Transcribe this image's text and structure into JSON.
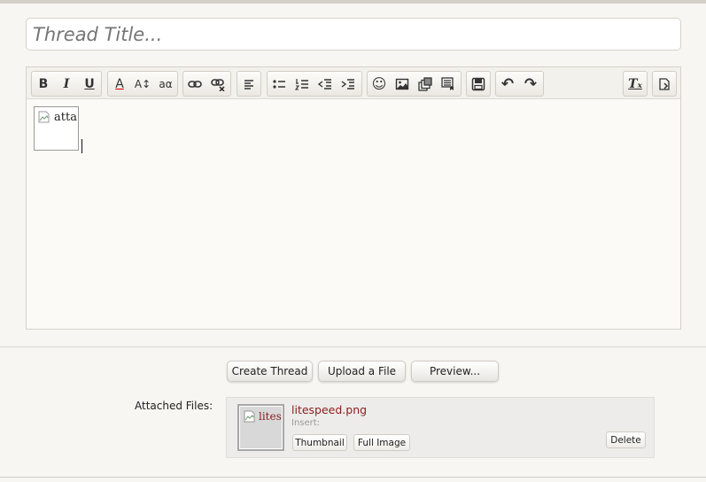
{
  "title_input": {
    "placeholder": "Thread Title..."
  },
  "toolbar": {
    "bold": "B",
    "italic": "I",
    "underline": "U",
    "text_color": "A",
    "font_size": "A↕",
    "font_family": "aα",
    "link": "link-icon",
    "unlink": "unlink-icon",
    "align": "align-left-icon",
    "bulleted_list": "bulleted-list-icon",
    "numbered_list": "numbered-list-icon",
    "outdent": "outdent-icon",
    "indent": "indent-icon",
    "smilies": "☺",
    "image": "image-icon",
    "media": "media-icon",
    "insert": "insert-icon",
    "save_draft": "save-icon",
    "undo": "↶",
    "redo": "↷",
    "remove_format": "Tₓ",
    "switch_mode": "toggle-bbcode-icon"
  },
  "editor": {
    "broken_image_alt": "atta"
  },
  "actions": {
    "create_thread": "Create Thread",
    "upload_file": "Upload a File",
    "preview": "Preview..."
  },
  "attachments": {
    "label": "Attached Files:",
    "file": {
      "name": "litespeed.png",
      "thumb_alt": "lites",
      "insert_label": "Insert:",
      "thumbnail_button": "Thumbnail",
      "full_image_button": "Full Image",
      "delete_button": "Delete"
    }
  },
  "colors": {
    "filename": "#8a1c1c",
    "background": "#f8f6f2"
  }
}
